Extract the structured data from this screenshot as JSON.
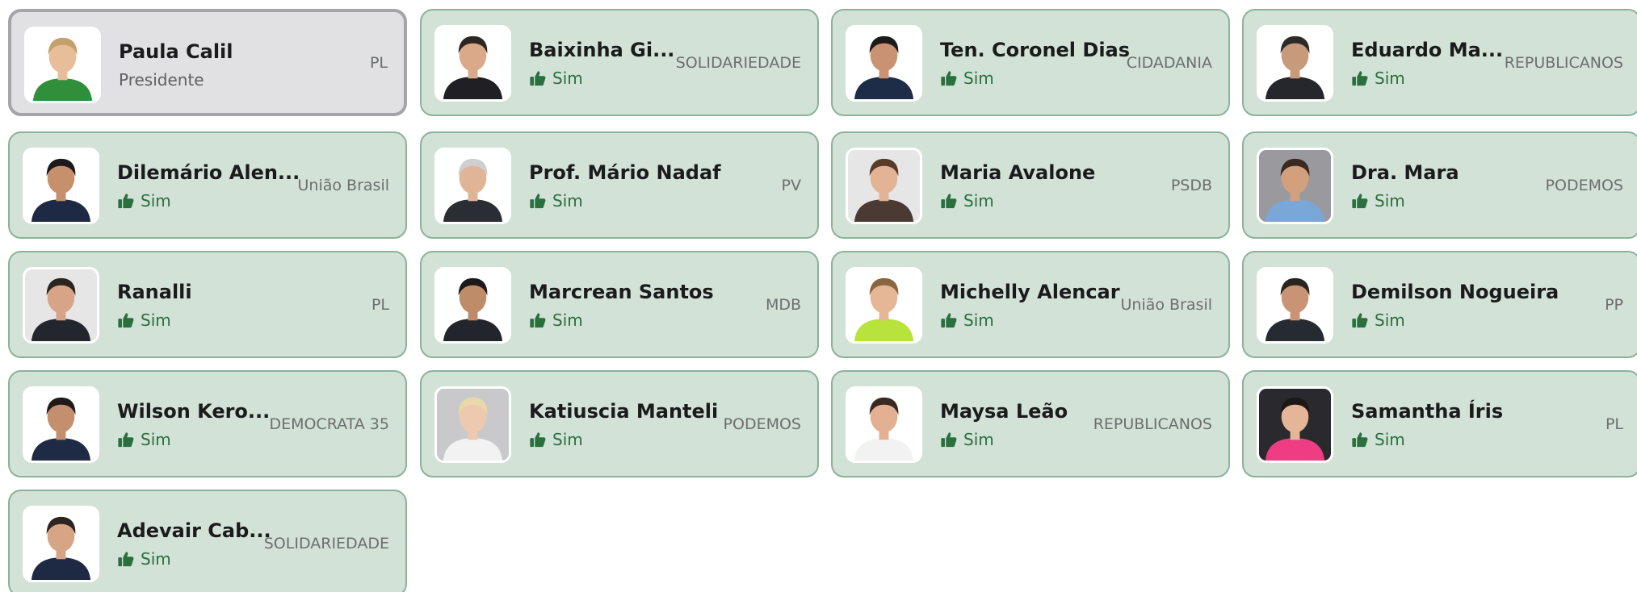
{
  "members": [
    {
      "name": "Paula Calil",
      "subtitle": "Presidente",
      "party": "PL",
      "type": "president",
      "shirt": "#2f8f3a",
      "skin": "#e8bd99",
      "hair": "#c4a06b",
      "bg": "#ffffff"
    },
    {
      "name": "Baixinha Gi...",
      "subtitle": "Sim",
      "party": "SOLIDARIEDADE",
      "type": "vote",
      "shirt": "#1f1f24",
      "skin": "#d9a98a",
      "hair": "#2e2622",
      "bg": "#ffffff"
    },
    {
      "name": "Ten. Coronel Dias",
      "subtitle": "Sim",
      "party": "CIDADANIA",
      "type": "vote",
      "shirt": "#1d2c47",
      "skin": "#c99272",
      "hair": "#1c1a1a",
      "bg": "#ffffff"
    },
    {
      "name": "Eduardo Ma...",
      "subtitle": "Sim",
      "party": "REPUBLICANOS",
      "type": "vote",
      "shirt": "#26272c",
      "skin": "#c89a7c",
      "hair": "#2d2a28",
      "bg": "#ffffff"
    },
    {
      "name": "Dilemário Alen...",
      "subtitle": "Sim",
      "party": "União Brasil",
      "type": "vote",
      "shirt": "#1e2a44",
      "skin": "#c6906d",
      "hair": "#1c1a1a",
      "bg": "#ffffff"
    },
    {
      "name": "Prof. Mário Nadaf",
      "subtitle": "Sim",
      "party": "PV",
      "type": "vote",
      "shirt": "#2a2d33",
      "skin": "#e0b597",
      "hair": "#cfcfcf",
      "bg": "#ffffff"
    },
    {
      "name": "Maria Avalone",
      "subtitle": "Sim",
      "party": "PSDB",
      "type": "vote",
      "shirt": "#4a3a33",
      "skin": "#e2b395",
      "hair": "#5a3b27",
      "bg": "#e6e6e6"
    },
    {
      "name": "Dra. Mara",
      "subtitle": "Sim",
      "party": "PODEMOS",
      "type": "vote",
      "shirt": "#7aa6d8",
      "skin": "#d2a07d",
      "hair": "#3a2a22",
      "bg": "#9a9a9e"
    },
    {
      "name": "Ranalli",
      "subtitle": "Sim",
      "party": "PL",
      "type": "vote",
      "shirt": "#23262d",
      "skin": "#d7a487",
      "hair": "#2b2522",
      "bg": "#e6e6e6"
    },
    {
      "name": "Marcrean Santos",
      "subtitle": "Sim",
      "party": "MDB",
      "type": "vote",
      "shirt": "#23252c",
      "skin": "#bf8c6a",
      "hair": "#1c1a1a",
      "bg": "#ffffff"
    },
    {
      "name": "Michelly Alencar",
      "subtitle": "Sim",
      "party": "União Brasil",
      "type": "vote",
      "shirt": "#b7e33a",
      "skin": "#e6b797",
      "hair": "#8a6640",
      "bg": "#ffffff"
    },
    {
      "name": "Demilson Nogueira",
      "subtitle": "Sim",
      "party": "PP",
      "type": "vote",
      "shirt": "#262a31",
      "skin": "#c99475",
      "hair": "#2a2420",
      "bg": "#ffffff"
    },
    {
      "name": "Wilson Kero...",
      "subtitle": "Sim",
      "party": "DEMOCRATA 35",
      "type": "vote",
      "shirt": "#1f2a44",
      "skin": "#c48f6e",
      "hair": "#1f1b1a",
      "bg": "#ffffff"
    },
    {
      "name": "Katiuscia Manteli",
      "subtitle": "Sim",
      "party": "PODEMOS",
      "type": "vote",
      "shirt": "#f2f2f2",
      "skin": "#edc9b0",
      "hair": "#ead9a8",
      "bg": "#c9c9cb"
    },
    {
      "name": "Maysa Leão",
      "subtitle": "Sim",
      "party": "REPUBLICANOS",
      "type": "vote",
      "shirt": "#f2f2f2",
      "skin": "#e3b091",
      "hair": "#3b2a21",
      "bg": "#ffffff"
    },
    {
      "name": "Samantha Íris",
      "subtitle": "Sim",
      "party": "PL",
      "type": "vote",
      "shirt": "#ee3d83",
      "skin": "#e4b596",
      "hair": "#1c1818",
      "bg": "#2a2a2e"
    },
    {
      "name": "Adevair Cab...",
      "subtitle": "Sim",
      "party": "SOLIDARIEDADE",
      "type": "vote",
      "shirt": "#1e2a44",
      "skin": "#d6a585",
      "hair": "#2b2420",
      "bg": "#ffffff"
    }
  ],
  "colors": {
    "vote_text": "#2a6f3e",
    "card_bg": "#d2e2d7",
    "card_border": "#8cb29a",
    "president_bg": "#e1e1e3",
    "president_border": "#a4a4a9"
  }
}
